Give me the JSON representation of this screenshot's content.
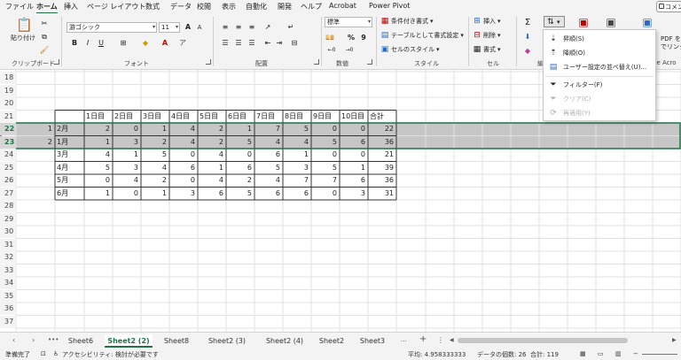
{
  "menu": {
    "tabs": [
      "ファイル",
      "ホーム",
      "挿入",
      "ページ レイアウト",
      "数式",
      "データ",
      "校閲",
      "表示",
      "自動化",
      "開発",
      "ヘルプ",
      "Acrobat",
      "Power Pivot"
    ],
    "active_tab": "ホーム",
    "comment_button": "コメント"
  },
  "ribbon": {
    "clipboard": {
      "paste_label": "貼り付け",
      "group_label": "クリップボード"
    },
    "font": {
      "font_name": "游ゴシック",
      "font_size": "11",
      "grow_font": "A",
      "shrink_font": "A",
      "bold": "B",
      "italic": "I",
      "underline": "U",
      "group_label": "フォント"
    },
    "alignment": {
      "group_label": "配置"
    },
    "number": {
      "format": "標準",
      "percent": "%",
      "comma": "9",
      "group_label": "数値"
    },
    "styles": {
      "conditional_formatting": "条件付き書式",
      "format_as_table": "テーブルとして書式設定",
      "cell_styles": "セルのスタイル",
      "group_label": "スタイル"
    },
    "cells": {
      "insert": "挿入",
      "delete": "削除",
      "format": "書式",
      "group_label": "セル"
    },
    "editing": {
      "group_label": "編"
    },
    "acrobat": {
      "create_pdf_line1": "PDF を",
      "create_pdf_line2": "でリンク",
      "group_label": "be Acro"
    }
  },
  "sort_menu": {
    "items": [
      {
        "label": "昇順(S)",
        "icon": "sort-ascending-icon",
        "enabled": true
      },
      {
        "label": "降順(O)",
        "icon": "sort-descending-icon",
        "enabled": true
      },
      {
        "label": "ユーザー設定の並べ替え(U)...",
        "icon": "custom-sort-icon",
        "enabled": true
      },
      {
        "label": "フィルター(F)",
        "icon": "filter-icon",
        "enabled": true
      },
      {
        "label": "クリア(C)",
        "icon": "clear-filter-icon",
        "enabled": false
      },
      {
        "label": "再適用(Y)",
        "icon": "reapply-icon",
        "enabled": false
      }
    ]
  },
  "sheet": {
    "row_numbers": [
      "18",
      "19",
      "20",
      "21",
      "22",
      "23",
      "24",
      "25",
      "26",
      "27",
      "28",
      "29",
      "30",
      "31",
      "32",
      "33",
      "34",
      "35",
      "36",
      "37"
    ],
    "table_header": [
      "1日目",
      "2日目",
      "3日目",
      "4日目",
      "5日目",
      "6日目",
      "7日目",
      "8日目",
      "9日目",
      "10日目",
      "合計"
    ],
    "rows": [
      {
        "index": "1",
        "month": "2月",
        "values": [
          "2",
          "0",
          "1",
          "4",
          "2",
          "1",
          "7",
          "5",
          "0",
          "0",
          "22"
        ],
        "selected": true
      },
      {
        "index": "2",
        "month": "1月",
        "values": [
          "1",
          "3",
          "2",
          "4",
          "2",
          "5",
          "4",
          "4",
          "5",
          "6",
          "36"
        ],
        "selected": true
      },
      {
        "index": "",
        "month": "3月",
        "values": [
          "4",
          "1",
          "5",
          "0",
          "4",
          "0",
          "6",
          "1",
          "0",
          "0",
          "21"
        ],
        "selected": false
      },
      {
        "index": "",
        "month": "4月",
        "values": [
          "5",
          "3",
          "4",
          "6",
          "1",
          "6",
          "5",
          "3",
          "5",
          "1",
          "39"
        ],
        "selected": false
      },
      {
        "index": "",
        "month": "5月",
        "values": [
          "0",
          "4",
          "2",
          "0",
          "4",
          "2",
          "4",
          "7",
          "7",
          "6",
          "36"
        ],
        "selected": false
      },
      {
        "index": "",
        "month": "6月",
        "values": [
          "1",
          "0",
          "1",
          "3",
          "6",
          "5",
          "6",
          "6",
          "0",
          "3",
          "31"
        ],
        "selected": false
      }
    ],
    "selection_color": "#c6c6c6",
    "accent_color": "#1f7246"
  },
  "sheet_tabs": {
    "tabs": [
      "Sheet6",
      "Sheet2 (2)",
      "Sheet8",
      "Sheet2 (3)",
      "Sheet2 (4)",
      "Sheet2",
      "Sheet3"
    ],
    "active": "Sheet2 (2)",
    "more": "...",
    "add": "+"
  },
  "status": {
    "ready": "準備完了",
    "accessibility": "アクセシビリティ: 検討が必要です",
    "average": "平均: 4.958333333",
    "count": "データの個数: 26",
    "sum": "合計: 119"
  }
}
